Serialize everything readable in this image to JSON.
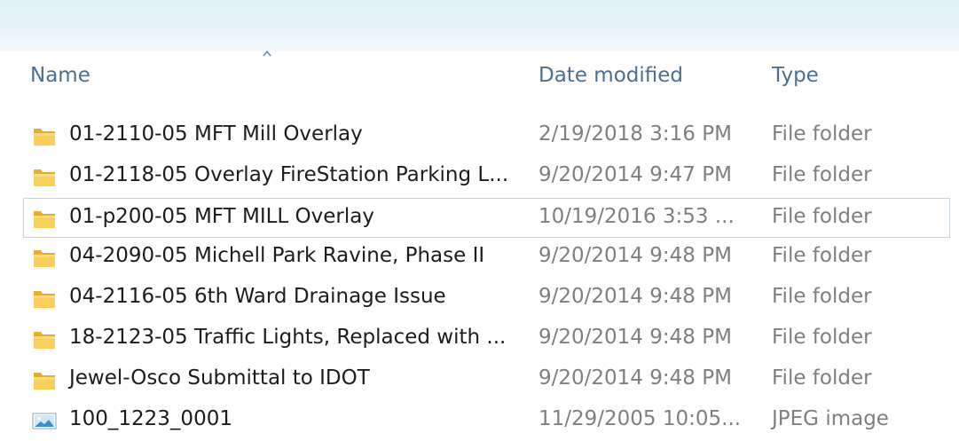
{
  "columns": {
    "name": "Name",
    "date_modified": "Date modified",
    "type": "Type"
  },
  "sort": {
    "column": "name",
    "indicator": "sort-up-icon"
  },
  "colors": {
    "header_text": "#4c6f91",
    "name_text": "#1c1c1c",
    "meta_text": "#7f7f7f",
    "folder": "#f5c64a",
    "selection_border": "#c9d3dc"
  },
  "files": [
    {
      "name": "01-2110-05 MFT Mill Overlay",
      "date": "2/19/2018 3:16 PM",
      "type": "File folder",
      "icon": "folder-icon"
    },
    {
      "name": "01-2118-05 Overlay FireStation Parking L...",
      "date": "9/20/2014 9:47 PM",
      "type": "File folder",
      "icon": "folder-icon"
    },
    {
      "name": "01-p200-05 MFT MILL Overlay",
      "date": "10/19/2016 3:53 ...",
      "type": "File folder",
      "icon": "folder-icon",
      "selected": true
    },
    {
      "name": "04-2090-05 Michell Park Ravine, Phase II",
      "date": "9/20/2014 9:48 PM",
      "type": "File folder",
      "icon": "folder-icon"
    },
    {
      "name": "04-2116-05 6th Ward Drainage Issue",
      "date": "9/20/2014 9:48 PM",
      "type": "File folder",
      "icon": "folder-icon"
    },
    {
      "name": "18-2123-05 Traffic Lights, Replaced with ...",
      "date": "9/20/2014 9:48 PM",
      "type": "File folder",
      "icon": "folder-icon"
    },
    {
      "name": "Jewel-Osco Submittal to IDOT",
      "date": "9/20/2014 9:48 PM",
      "type": "File folder",
      "icon": "folder-icon"
    },
    {
      "name": "100_1223_0001",
      "date": "11/29/2005 10:05...",
      "type": "JPEG image",
      "icon": "image-file-icon"
    }
  ]
}
